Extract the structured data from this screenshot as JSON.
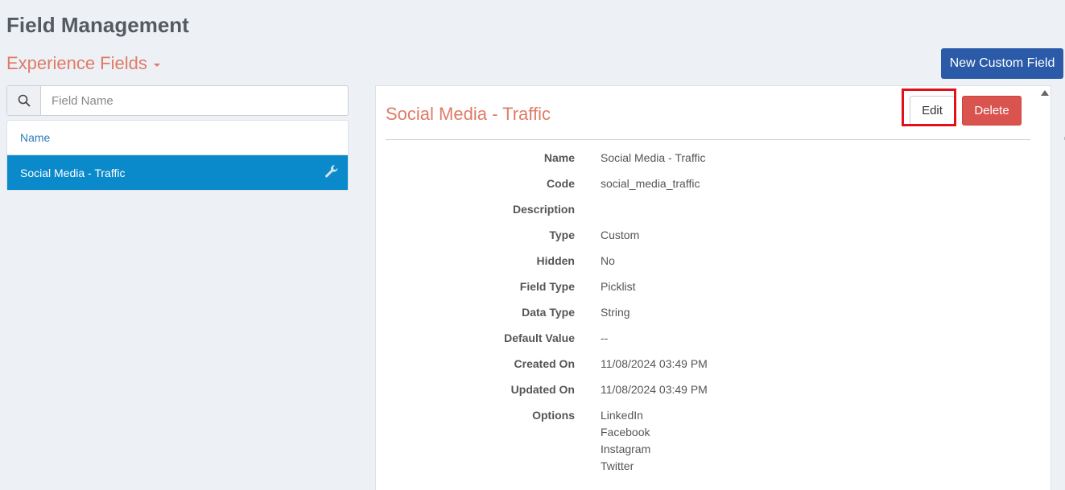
{
  "page": {
    "title": "Field Management"
  },
  "section": {
    "label": "Experience Fields"
  },
  "toolbar": {
    "new_custom_field_label": "New Custom Field"
  },
  "search": {
    "placeholder": "Field Name",
    "value": ""
  },
  "field_list": {
    "header": "Name",
    "items": [
      {
        "label": "Social Media - Traffic",
        "selected": true
      }
    ]
  },
  "detail": {
    "title": "Social Media - Traffic",
    "edit_label": "Edit",
    "delete_label": "Delete",
    "fields": [
      {
        "label": "Name",
        "value": "Social Media - Traffic"
      },
      {
        "label": "Code",
        "value": "social_media_traffic"
      },
      {
        "label": "Description",
        "value": ""
      },
      {
        "label": "Type",
        "value": "Custom"
      },
      {
        "label": "Hidden",
        "value": "No"
      },
      {
        "label": "Field Type",
        "value": "Picklist"
      },
      {
        "label": "Data Type",
        "value": "String"
      },
      {
        "label": "Default Value",
        "value": "--"
      },
      {
        "label": "Created On",
        "value": "11/08/2024 03:49 PM"
      },
      {
        "label": "Updated On",
        "value": "11/08/2024 03:49 PM"
      },
      {
        "label": "Options",
        "values": [
          "LinkedIn",
          "Facebook",
          "Instagram",
          "Twitter"
        ]
      }
    ]
  },
  "icons": {
    "search": "search-icon",
    "caret": "caret-down-icon",
    "wrench": "wrench-icon",
    "scroll_up": "scroll-up-arrow-icon"
  },
  "colors": {
    "background": "#edf0f5",
    "accent": "#e07b67",
    "primary_button": "#2a5aa8",
    "selected_row": "#0b8acb",
    "danger": "#d9534f",
    "highlight": "#e3101b"
  }
}
